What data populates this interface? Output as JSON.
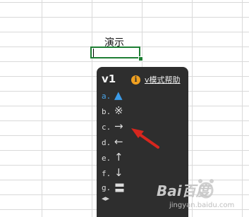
{
  "spreadsheet": {
    "cell_text": "演示"
  },
  "popup": {
    "title": "v1",
    "help_link": "v模式帮助",
    "options": [
      {
        "key": "a.",
        "symbol": "▲",
        "icon": "triangle-up-icon",
        "active": true
      },
      {
        "key": "b.",
        "symbol": "※",
        "icon": "reference-mark-icon",
        "active": false
      },
      {
        "key": "c.",
        "symbol": "→",
        "icon": "arrow-right-icon",
        "active": false
      },
      {
        "key": "d.",
        "symbol": "←",
        "icon": "arrow-left-icon",
        "active": false
      },
      {
        "key": "e.",
        "symbol": "↑",
        "icon": "arrow-up-icon",
        "active": false
      },
      {
        "key": "f.",
        "symbol": "↓",
        "icon": "arrow-down-icon",
        "active": false
      },
      {
        "key": "g.",
        "symbol": "〓",
        "icon": "double-bar-icon",
        "active": false
      }
    ],
    "nav_symbol": "◂▸"
  },
  "watermark": {
    "text": "Bai百度",
    "sub": "jingyan.baidu.com"
  },
  "colors": {
    "selection": "#1e7e34",
    "popup_bg": "#2e2e2e",
    "active_option": "#3b9be8",
    "annotation_arrow": "#d6261e"
  }
}
